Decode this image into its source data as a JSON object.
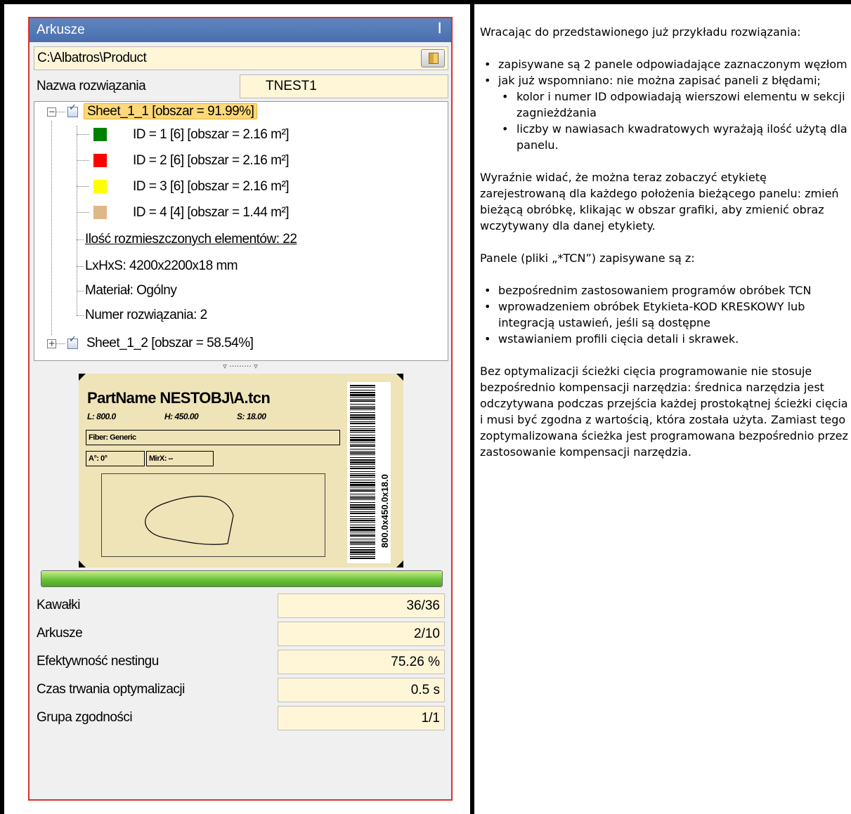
{
  "panel": {
    "title": "Arkusze",
    "pin_icon": "pin-icon",
    "path": "C:\\Albatros\\Product",
    "name_label": "Nazwa rozwiązania",
    "name_value": "TNEST1"
  },
  "tree": {
    "sheet1": "Sheet_1_1 [obszar = 91.99%]",
    "items": [
      {
        "color": "#008000",
        "label": "ID = 1 [6] [obszar = 2.16 m²]"
      },
      {
        "color": "#ff0000",
        "label": "ID = 2 [6] [obszar = 2.16 m²]"
      },
      {
        "color": "#ffff00",
        "label": "ID = 3 [6] [obszar = 2.16 m²]"
      },
      {
        "color": "#deb887",
        "label": "ID = 4 [4] [obszar = 1.44 m²]"
      }
    ],
    "placed": "Ilość rozmieszczonych elementów: 22",
    "dims": "LxHxS: 4200x2200x18  mm",
    "material": "Materiał: Ogólny",
    "solution": "Numer rozwiązania: 2",
    "sheet2": "Sheet_1_2 [obszar = 58.54%]"
  },
  "label_preview": {
    "title": "PartName NESTOBJ\\A.tcn",
    "l": "L: 800.0",
    "h": "H: 450.00",
    "s": "S: 18.00",
    "fiber": "Fiber: Generic",
    "angle": "A°: 0°",
    "mirx": "MirX: --",
    "barcode_text": "800.0x450.0x18.0"
  },
  "progress": {
    "fraction": 1.0
  },
  "stats": [
    {
      "label": "Kawałki",
      "value": "36/36"
    },
    {
      "label": "Arkusze",
      "value": "2/10"
    },
    {
      "label": "Efektywność nestingu",
      "value": "75.26 %"
    },
    {
      "label": "Czas trwania optymalizacji",
      "value": "0.5 s"
    },
    {
      "label": "Grupa zgodności",
      "value": "1/1"
    }
  ],
  "text": {
    "p1": "Wracając do przedstawionego już przykładu rozwiązania:",
    "b1": "zapisywane są 2 panele odpowiadające zaznaczonym węzłom",
    "b2": "jak już wspomniano: nie można zapisać paneli z błędami;",
    "b2a": "kolor i numer ID odpowiadają wierszowi elementu w sekcji zagnieżdżania",
    "b2b": "liczby w nawiasach kwadratowych wyrażają ilość użytą dla panelu.",
    "p2": "Wyraźnie widać, że można teraz zobaczyć etykietę zarejestrowaną dla każdego położenia bieżącego panelu: zmień bieżącą obróbkę, klikając w obszar grafiki, aby zmienić obraz wczytywany dla danej etykiety.",
    "p3": "Panele (pliki „*TCN”) zapisywane są z:",
    "c1": "bezpośrednim zastosowaniem programów obróbek TCN",
    "c2": "wprowadzeniem obróbek Etykieta-KOD KRESKOWY lub integracją ustawień, jeśli są dostępne",
    "c3": "wstawianiem profili cięcia detali i skrawek.",
    "p4": "Bez optymalizacji ścieżki cięcia programowanie nie stosuje bezpośrednio kompensacji narzędzia: średnica narzędzia jest odczytywana podczas przejścia każdej prostokątnej ścieżki cięcia i musi być zgodna z wartością, która została użyta. Zamiast tego zoptymalizowana ścieżka jest programowana bezpośrednio przez zastosowanie kompensacji narzędzia."
  }
}
